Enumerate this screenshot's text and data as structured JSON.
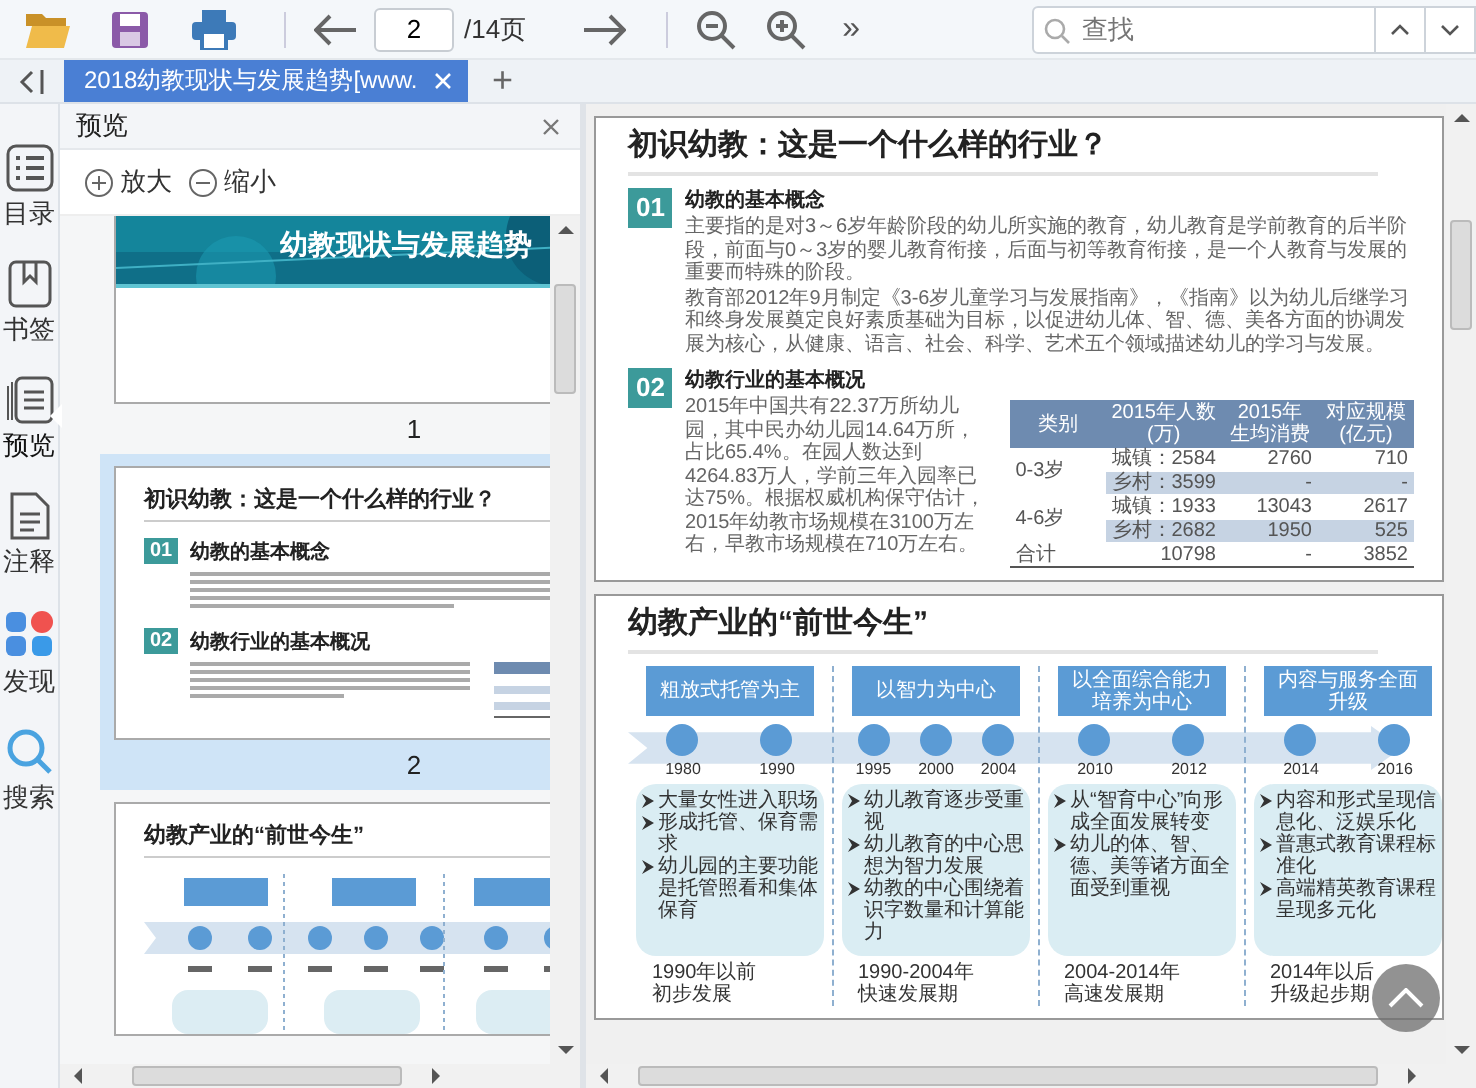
{
  "toolbar": {
    "page_input": "2",
    "page_total": "/14页",
    "more": "»",
    "search": {
      "placeholder": "查找"
    }
  },
  "tabs": [
    {
      "label": "2018幼教现状与发展趋势[www.",
      "selected": true
    }
  ],
  "new_tab": "+",
  "rail": [
    {
      "kind": "contents",
      "label": "目录",
      "selected": false
    },
    {
      "kind": "bookmarks",
      "label": "书签",
      "selected": false
    },
    {
      "kind": "preview",
      "label": "预览",
      "selected": true
    },
    {
      "kind": "notes",
      "label": "注释",
      "selected": false
    },
    {
      "kind": "discover",
      "label": "发现",
      "selected": false
    },
    {
      "kind": "search",
      "label": "搜索",
      "selected": false
    }
  ],
  "preview_panel": {
    "title": "预览",
    "zoom_in": "放大",
    "zoom_out": "缩小",
    "thumbnails": [
      {
        "kind": "cover",
        "page": "1",
        "selected": false,
        "banner": "幼教现状与发展趋势"
      },
      {
        "kind": "intro",
        "page": "2",
        "selected": true,
        "title": "初识幼教：这是一个什么样的行业？",
        "sections": [
          {
            "num": "01",
            "heading": "幼教的基本概念"
          },
          {
            "num": "02",
            "heading": "幼教行业的基本概况"
          }
        ]
      },
      {
        "kind": "timeline",
        "selected": false,
        "title": "幼教产业的“前世今生”"
      }
    ]
  },
  "pages": [
    {
      "kind": "intro",
      "title": "初识幼教：这是一个什么样的行业？",
      "sections": [
        {
          "num": "01",
          "heading": "幼教的基本概念",
          "paragraphs": [
            "主要指的是对3～6岁年龄阶段的幼儿所实施的教育，幼儿教育是学前教育的后半阶段，前面与0～3岁的婴儿教育衔接，后面与初等教育衔接，是一个人教育与发展的重要而特殊的阶段。",
            "教育部2012年9月制定《3-6岁儿童学习与发展指南》，《指南》以为幼儿后继学习和终身发展奠定良好素质基础为目标，以促进幼儿体、智、德、美各方面的协调发展为核心，从健康、语言、社会、科学、艺术五个领域描述幼儿的学习与发展。"
          ]
        },
        {
          "num": "02",
          "heading": "幼教行业的基本概况",
          "paragraphs": [
            "2015年中国共有22.37万所幼儿园，其中民办幼儿园14.64万所，占比65.4%。在园人数达到4264.83万人，学前三年入园率已达75%。根据权威机构保守估计，2015年幼教市场规模在3100万左右，早教市场规模在710万左右。"
          ],
          "table": {
            "columns": [
              "类别",
              "2015年人数(万)",
              "2015年生均消费",
              "对应规模(亿元)"
            ],
            "rows": [
              {
                "cells": [
                  {
                    "text": "0-3岁",
                    "rowspan": 2
                  },
                  "城镇：2584",
                  "2760",
                  "710"
                ]
              },
              {
                "cells": [
                  "乡村：3599",
                  "-",
                  "-"
                ]
              },
              {
                "cells": [
                  {
                    "text": "4-6岁",
                    "rowspan": 2
                  },
                  "城镇：1933",
                  "13043",
                  "2617"
                ]
              },
              {
                "cells": [
                  "乡村：2682",
                  "1950",
                  "525"
                ]
              },
              {
                "cells": [
                  "合计",
                  "10798",
                  "-",
                  "3852"
                ]
              }
            ]
          }
        }
      ]
    },
    {
      "kind": "timeline",
      "title": "幼教产业的“前世今生”",
      "stages": [
        {
          "label": "粗放式托管为主",
          "years": [
            "1980",
            "1990"
          ],
          "bullets": [
            "大量女性进入职场",
            "形成托管、保育需求",
            "幼儿园的主要功能是托管照看和集体保育"
          ],
          "period": [
            "1990年以前",
            "初步发展"
          ]
        },
        {
          "label": "以智力为中心",
          "years": [
            "1995",
            "2000",
            "2004"
          ],
          "bullets": [
            "幼儿教育逐步受重视",
            "幼儿教育的中心思想为智力发展",
            "幼教的中心围绕着识字数量和计算能力"
          ],
          "period": [
            "1990-2004年",
            "快速发展期"
          ]
        },
        {
          "label": "以全面综合能力培养为中心",
          "years": [
            "2010",
            "2012"
          ],
          "bullets": [
            "从“智育中心”向形成全面发展转变",
            "幼儿的体、智、德、美等诸方面全面受到重视"
          ],
          "period": [
            "2004-2014年",
            "高速发展期"
          ]
        },
        {
          "label": "内容与服务全面升级",
          "years": [
            "2014",
            "2016"
          ],
          "bullets": [
            "内容和形式呈现信息化、泛娱乐化",
            "普惠式教育课程标准化",
            "高端精英教育课程呈现多元化"
          ],
          "period": [
            "2014年以后",
            "升级起步期"
          ]
        }
      ]
    }
  ]
}
